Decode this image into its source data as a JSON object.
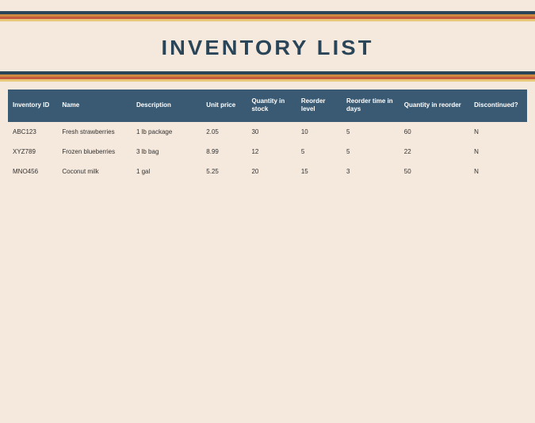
{
  "title": "INVENTORY  LIST",
  "columns": {
    "inventory_id": "Inventory ID",
    "name": "Name",
    "description": "Description",
    "unit_price": "Unit price",
    "quantity_in_stock": "Quantity in stock",
    "reorder_level": "Reorder level",
    "reorder_time": "Reorder time in days",
    "quantity_in_reorder": "Quantity in reorder",
    "discontinued": "Discontinued?"
  },
  "rows": [
    {
      "inventory_id": "ABC123",
      "name": "Fresh strawberries",
      "description": "1 lb package",
      "unit_price": "2.05",
      "quantity_in_stock": "30",
      "reorder_level": "10",
      "reorder_time": "5",
      "quantity_in_reorder": "60",
      "discontinued": "N"
    },
    {
      "inventory_id": "XYZ789",
      "name": "Frozen blueberries",
      "description": "3 lb bag",
      "unit_price": "8.99",
      "quantity_in_stock": "12",
      "reorder_level": "5",
      "reorder_time": "5",
      "quantity_in_reorder": "22",
      "discontinued": "N"
    },
    {
      "inventory_id": "MNO456",
      "name": "Coconut milk",
      "description": "1 gal",
      "unit_price": "5.25",
      "quantity_in_stock": "20",
      "reorder_level": "15",
      "reorder_time": "3",
      "quantity_in_reorder": "50",
      "discontinued": "N"
    }
  ],
  "colors": {
    "navy": "#2a4558",
    "teal_header": "#3a5a73",
    "orange": "#d08a3f",
    "red": "#c65a3f",
    "yellow": "#e8c97a",
    "cream_bg": "#f5e8dc"
  }
}
